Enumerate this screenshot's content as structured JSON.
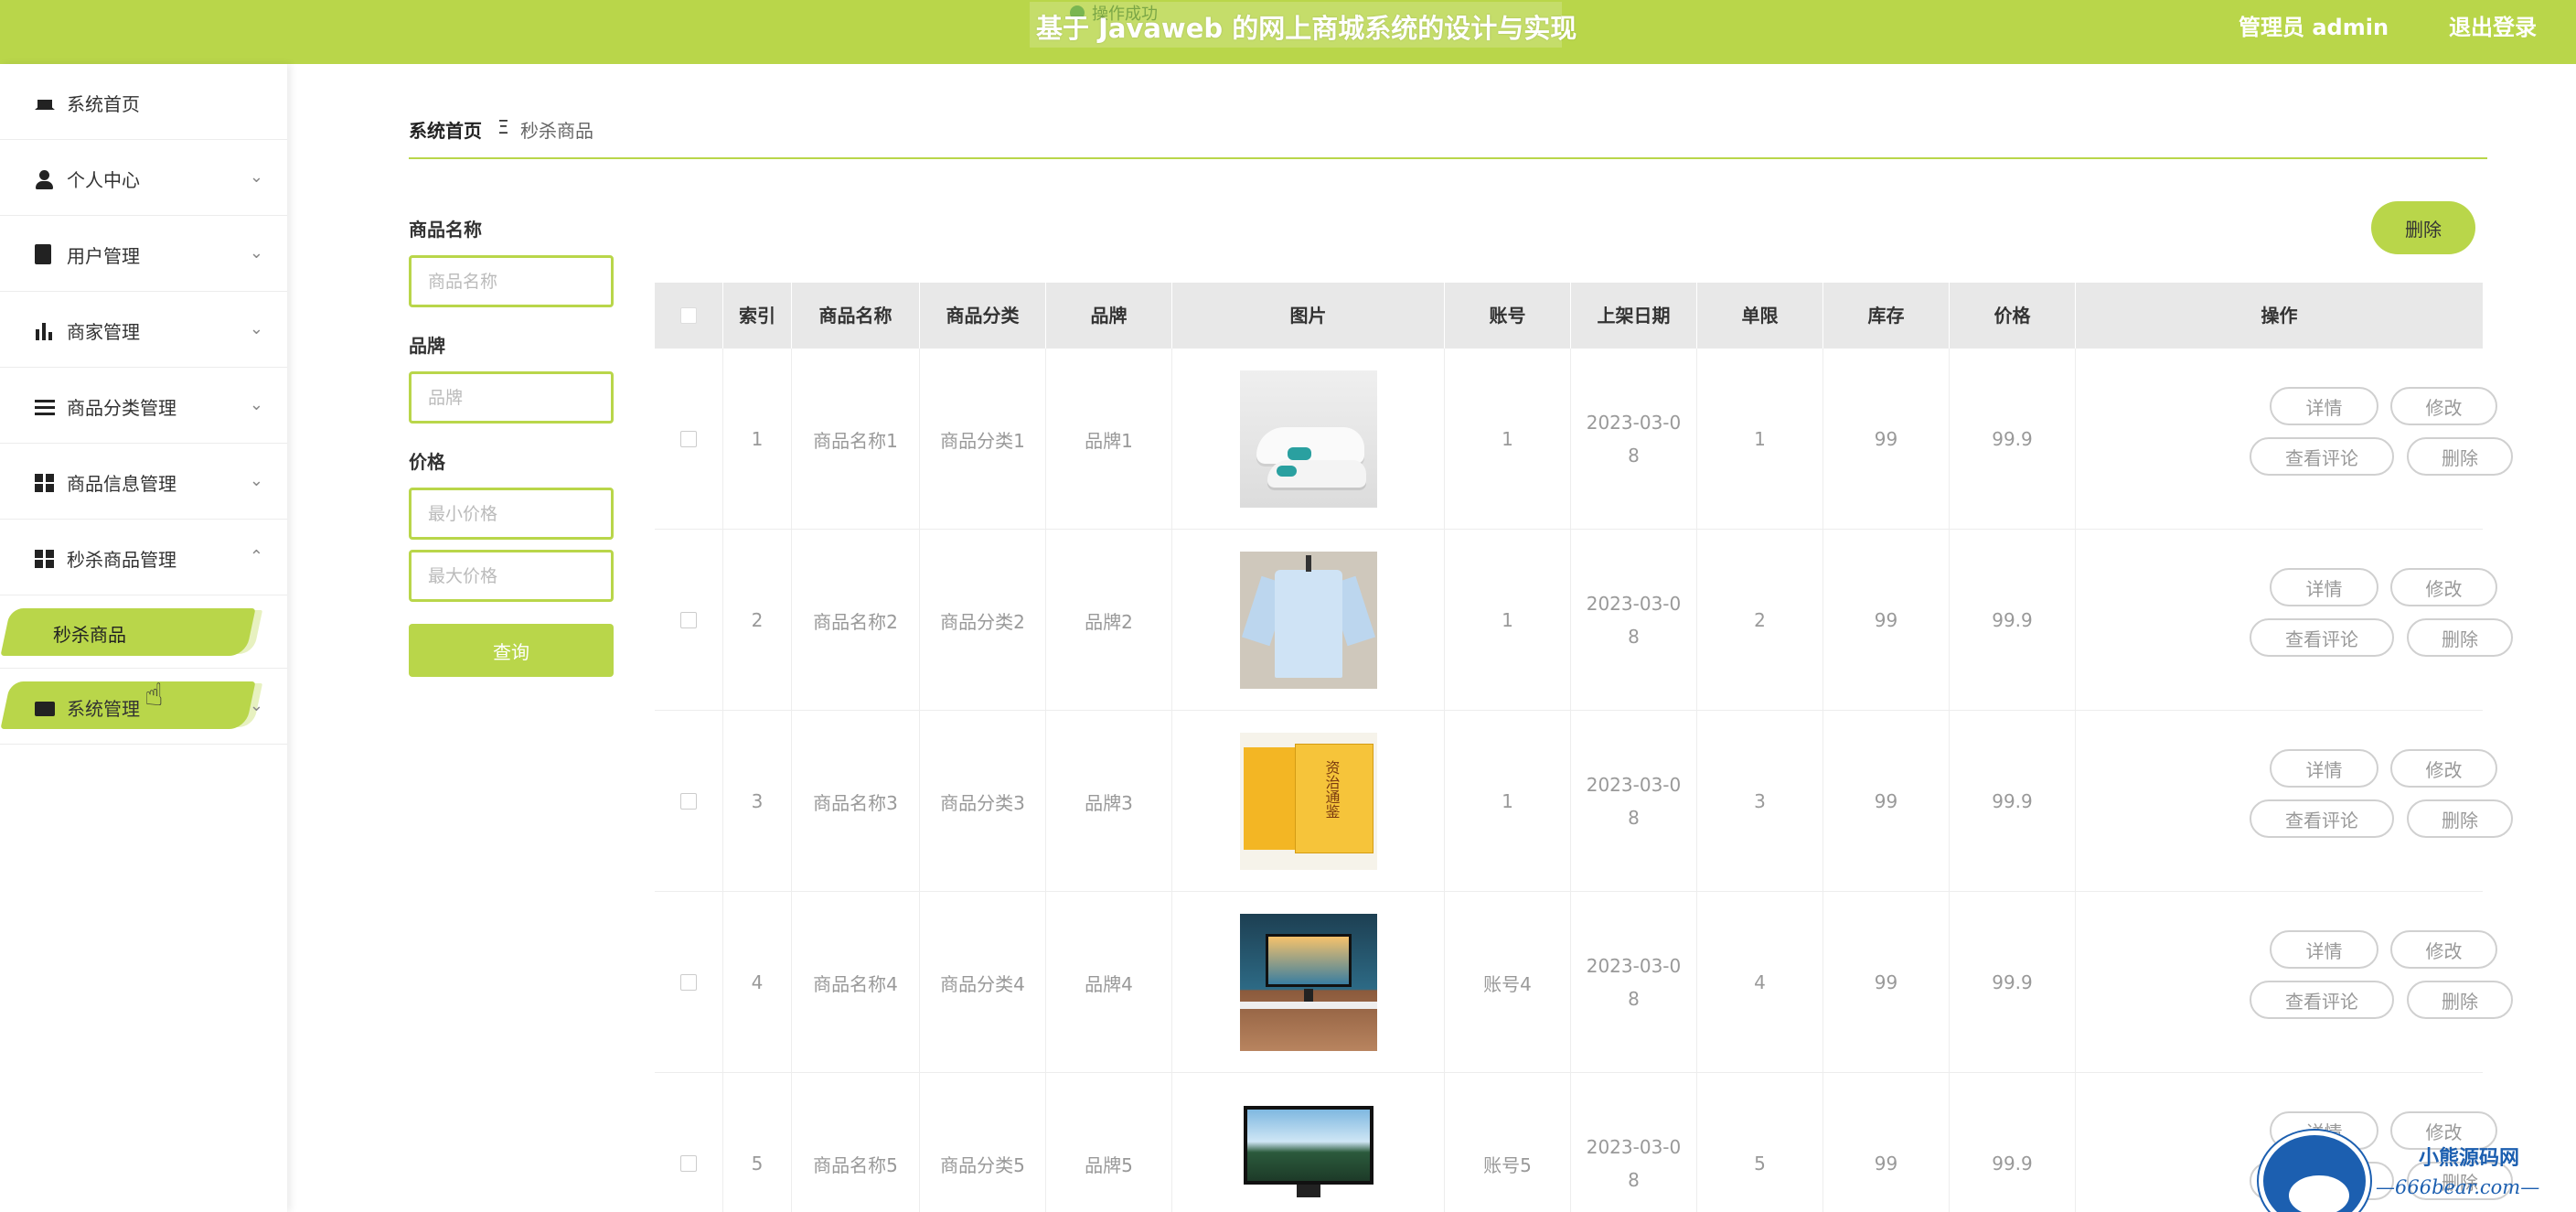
{
  "header": {
    "title": "基于 Javaweb 的网上商城系统的设计与实现",
    "toast": "操作成功",
    "admin_label": "管理员 admin",
    "logout_label": "退出登录"
  },
  "sidebar": {
    "items": [
      {
        "label": "系统首页",
        "icon": "home-icon"
      },
      {
        "label": "个人中心",
        "icon": "user-icon"
      },
      {
        "label": "用户管理",
        "icon": "clipboard-icon"
      },
      {
        "label": "商家管理",
        "icon": "bar-chart-icon"
      },
      {
        "label": "商品分类管理",
        "icon": "list-icon"
      },
      {
        "label": "商品信息管理",
        "icon": "grid-icon"
      },
      {
        "label": "秒杀商品管理",
        "icon": "grid-icon"
      },
      {
        "label": "系统管理",
        "icon": "wallet-icon"
      }
    ],
    "sub_item": "秒杀商品",
    "chevron_down": "⌄",
    "chevron_up": "⌃"
  },
  "breadcrumb": {
    "home": "系统首页",
    "separator": "Ξ",
    "current": "秒杀商品"
  },
  "filters": {
    "name_label": "商品名称",
    "name_placeholder": "商品名称",
    "brand_label": "品牌",
    "brand_placeholder": "品牌",
    "price_label": "价格",
    "min_placeholder": "最小价格",
    "max_placeholder": "最大价格",
    "search_label": "查询"
  },
  "actions": {
    "delete_label": "删除"
  },
  "table": {
    "columns": [
      "索引",
      "商品名称",
      "商品分类",
      "品牌",
      "图片",
      "账号",
      "上架日期",
      "单限",
      "库存",
      "价格",
      "操作"
    ],
    "rows": [
      {
        "index": "1",
        "name": "商品名称1",
        "category": "商品分类1",
        "brand": "品牌1",
        "image": "sneaker-photo",
        "account": "1",
        "date": "2023-03-08",
        "limit": "1",
        "stock": "99",
        "price": "99.9"
      },
      {
        "index": "2",
        "name": "商品名称2",
        "category": "商品分类2",
        "brand": "品牌2",
        "image": "shirt-photo",
        "account": "1",
        "date": "2023-03-08",
        "limit": "2",
        "stock": "99",
        "price": "99.9"
      },
      {
        "index": "3",
        "name": "商品名称3",
        "category": "商品分类3",
        "brand": "品牌3",
        "image": "book-set-photo",
        "account": "1",
        "date": "2023-03-08",
        "limit": "3",
        "stock": "99",
        "price": "99.9"
      },
      {
        "index": "4",
        "name": "商品名称4",
        "category": "商品分类4",
        "brand": "品牌4",
        "image": "desk-setup-photo",
        "account": "账号4",
        "date": "2023-03-08",
        "limit": "4",
        "stock": "99",
        "price": "99.9"
      },
      {
        "index": "5",
        "name": "商品名称5",
        "category": "商品分类5",
        "brand": "品牌5",
        "image": "tv-photo",
        "account": "账号5",
        "date": "2023-03-08",
        "limit": "5",
        "stock": "99",
        "price": "99.9"
      }
    ],
    "ops": {
      "detail": "详情",
      "edit": "修改",
      "review": "查看评论",
      "delete": "删除"
    },
    "book_cover_text": "资治通鉴"
  },
  "watermark": {
    "name": "小熊源码网",
    "url": "—666bear.com—"
  },
  "colors": {
    "accent": "#b9d64a",
    "watermark": "#1c5fb0"
  }
}
